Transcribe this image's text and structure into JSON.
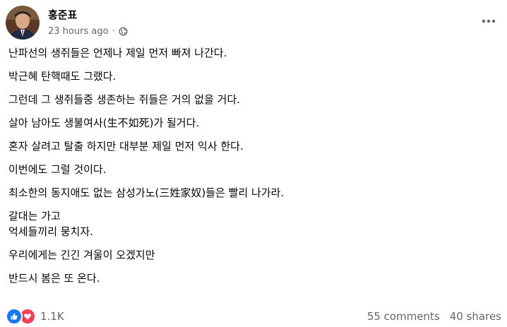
{
  "post": {
    "author": "홍준표",
    "timestamp": "23 hours ago",
    "separator": "·",
    "audience_icon": "globe-icon",
    "more_icon": "more-horizontal-icon",
    "paragraphs": [
      "난파선의 생쥐들은 언제나 제일 먼저 빠져 나간다.",
      "박근혜 탄핵때도 그랬다.",
      "그런데 그 생쥐들중 생존하는 쥐들은 거의 없을 거다.",
      "살아 남아도 생불여사(生不如死)가 될거다.",
      "혼자 살려고 탈출 하지만 대부분 제일 먼저 익사 한다.",
      "이번에도 그럴 것이다.",
      "최소한의 동지애도 없는 삼성가노(三姓家奴)들은 빨리 나가라.",
      "갈대는 가고\n억세들끼리 뭉치자.",
      "우리에게는 긴긴 겨울이 오겠지만",
      "반드시 봄은 또 온다."
    ],
    "reactions": {
      "icons": [
        "like-icon",
        "love-icon"
      ],
      "count": "1.1K"
    },
    "comments": "55 comments",
    "shares": "40 shares",
    "colors": {
      "like": "#1877f2",
      "love": "#f33e58",
      "secondary_text": "#65676b",
      "primary_text": "#050505"
    }
  }
}
